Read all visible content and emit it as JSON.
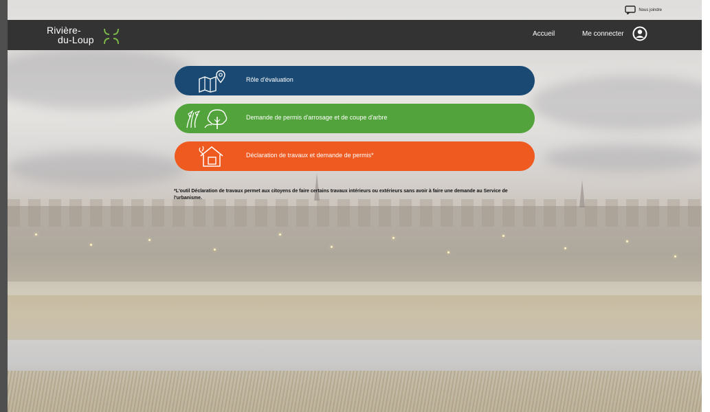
{
  "contact": {
    "label": "Nous joindre",
    "icon": "chat-bubble-icon"
  },
  "header": {
    "logo_line1": "Rivière-",
    "logo_line2": "du-Loup",
    "logo_mark_color": "#7ab648",
    "nav": {
      "home_label": "Accueil",
      "login_label": "Me connecter"
    },
    "background": "#333333"
  },
  "actions": [
    {
      "label": "Rôle d'évaluation",
      "color": "#1a4a73",
      "icon": "map-pin-icon"
    },
    {
      "label": "Demande de permis d'arrosage et de coupe d'arbre",
      "color": "#52a33b",
      "icon": "tree-icon"
    },
    {
      "label": "Déclaration de travaux et demande de permis*",
      "color": "#ee5a20",
      "icon": "house-tools-icon"
    }
  ],
  "footnote": "*L'outil Déclaration de travaux permet aux citoyens de faire certains travaux intérieurs ou extérieurs sans avoir à faire une demande au Service de l'urbanisme."
}
